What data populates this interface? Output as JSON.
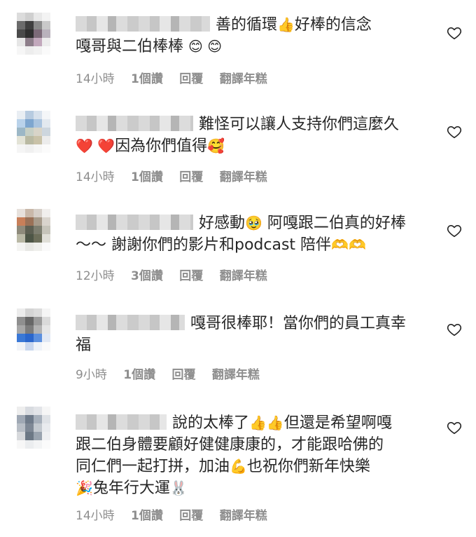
{
  "comments": [
    {
      "text_a": "善的循環",
      "emoji_a": "👍",
      "text_b": "好棒的信念\n嘎哥與二伯棒棒",
      "emoji_b": "😊 😊",
      "time": "14小時",
      "likes": "1個讚",
      "reply": "回覆",
      "translate": "翻譯年糕"
    },
    {
      "text_a": "難怪可以讓人支持你們這麼久\n",
      "emoji_a": "❤️ ❤️",
      "text_b": "因為你們值得",
      "emoji_b": "🥰",
      "time": "14小時",
      "likes": "1個讚",
      "reply": "回覆",
      "translate": "翻譯年糕"
    },
    {
      "text_a": "好感動",
      "emoji_a": "🥹",
      "text_b": " 阿嘎跟二伯真的好棒\n～～ 謝謝你們的影片和podcast 陪伴",
      "emoji_b": "🫶🫶",
      "time": "12小時",
      "likes": "3個讚",
      "reply": "回覆",
      "translate": "翻譯年糕"
    },
    {
      "text_a": "嘎哥很棒耶！當你們的員工真幸\n福",
      "emoji_a": "",
      "text_b": "",
      "emoji_b": "",
      "time": "9小時",
      "likes": "1個讚",
      "reply": "回覆",
      "translate": "翻譯年糕"
    },
    {
      "text_a": "說的太棒了",
      "emoji_a": "👍👍",
      "text_b": "但還是希望啊嘎\n跟二伯身體要顧好健健康康的，才能跟哈佛的\n同仁們一起打拼，加油",
      "emoji_b": "💪",
      "text_c": "也祝你們新年快樂\n",
      "emoji_c": "🎉",
      "text_d": "兔年行大運",
      "emoji_d": "🐰",
      "time": "14小時",
      "likes": "1個讚",
      "reply": "回覆",
      "translate": "翻譯年糕"
    }
  ],
  "colors": {
    "text": "#262626",
    "meta": "#8e8e8e",
    "heart_stroke": "#262626"
  },
  "icons": {
    "like": "heart-outline-icon"
  }
}
